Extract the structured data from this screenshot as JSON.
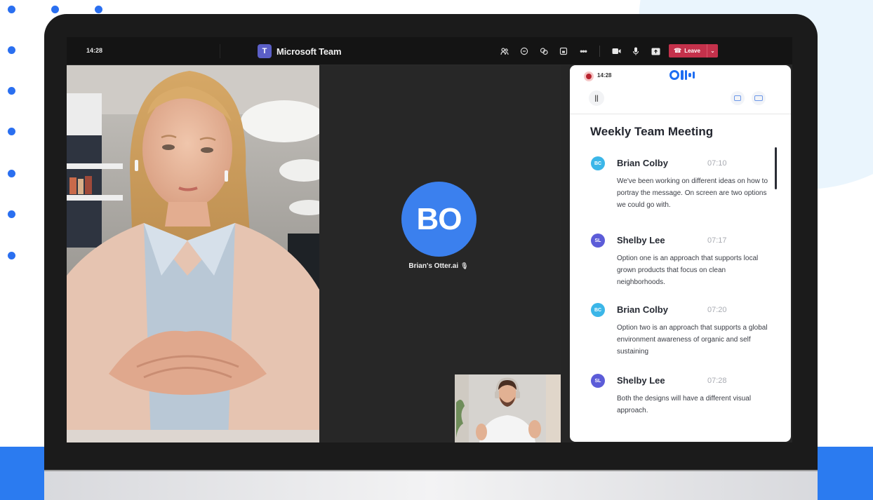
{
  "colors": {
    "brand_blue": "#2b7bf0",
    "teams_purple": "#5b5fc7",
    "leave_red": "#c4314b",
    "otter_blue": "#1f6ef2",
    "avatar_bc": "#3bb6e8",
    "avatar_sl": "#5c5cd8",
    "avatar_bo": "#3b80ee"
  },
  "teams": {
    "time": "14:28",
    "app_title": "Microsoft Team",
    "toolbar_icons": [
      "participants-icon",
      "chat-icon",
      "react-icon",
      "share-tray-icon",
      "more-icon",
      "camera-icon",
      "mic-icon",
      "share-screen-icon"
    ],
    "leave_label": "Leave"
  },
  "center_tile": {
    "initials": "BO",
    "participant_name": "Brian's Otter.ai"
  },
  "otter": {
    "recording_time": "14:28",
    "meeting_title": "Weekly Team Meeting",
    "transcript": [
      {
        "initials": "BC",
        "speaker": "Brian Colby",
        "timestamp": "07:10",
        "text": "We've been working on different ideas on how to portray the message. On screen are two options we could go with."
      },
      {
        "initials": "SL",
        "speaker": "Shelby Lee",
        "timestamp": "07:17",
        "text": "Option one is an approach that supports local grown products that focus on clean neighborhoods."
      },
      {
        "initials": "BC",
        "speaker": "Brian Colby",
        "timestamp": "07:20",
        "text": "Option two is an approach that supports a global environment awareness of organic and self sustaining"
      },
      {
        "initials": "SL",
        "speaker": "Shelby Lee",
        "timestamp": "07:28",
        "text": "Both the designs will have a different visual approach."
      }
    ]
  }
}
